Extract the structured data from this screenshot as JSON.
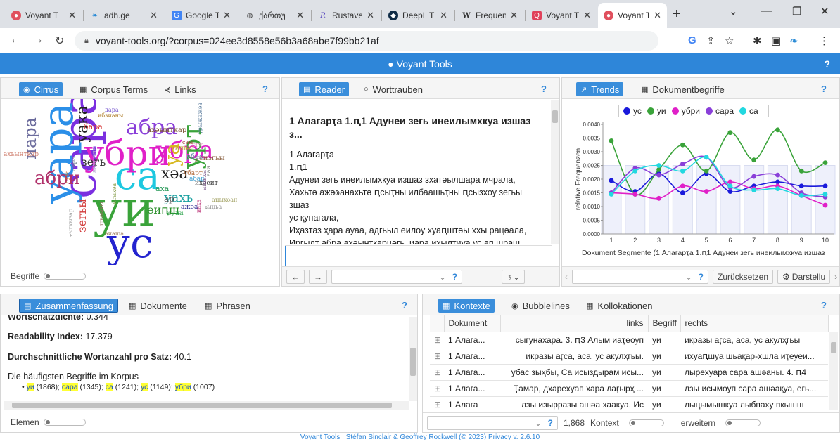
{
  "browser": {
    "tabs": [
      {
        "label": "Voyant T",
        "icon": "voyant-icon",
        "color": "#e0505e"
      },
      {
        "label": "adh.ge",
        "icon": "adh-icon",
        "color": "#2a8bd6"
      },
      {
        "label": "Google T",
        "icon": "translate-icon",
        "color": "#4285f4"
      },
      {
        "label": "ქართუ",
        "icon": "globe-icon",
        "color": "#444444"
      },
      {
        "label": "Rustave",
        "icon": "rustaveli-icon",
        "color": "#5b4bbf"
      },
      {
        "label": "DeepL T",
        "icon": "deepl-icon",
        "color": "#0f2b46"
      },
      {
        "label": "Frequen",
        "icon": "wikipedia-icon",
        "color": "#333333"
      },
      {
        "label": "Voyant T",
        "icon": "voyant-red-icon",
        "color": "#e0405a"
      },
      {
        "label": "Voyant T",
        "icon": "voyant-icon",
        "color": "#e0505e"
      }
    ],
    "url": "voyant-tools.org/?corpus=024ee3d8558e56b3a68abe7f99bb21af"
  },
  "app": {
    "title": "Voyant Tools",
    "help": "?"
  },
  "cirrus": {
    "tabs": [
      "Cirrus",
      "Corpus Terms",
      "Links"
    ],
    "help": "?",
    "slider_label": "Begriffe"
  },
  "reader": {
    "tabs": [
      "Reader",
      "Worttrauben"
    ],
    "help": "?",
    "title": "1 Алагарҭа 1.ԥ1 Адунеи зегь инеилымхкуа изшаз з...",
    "lines": [
      "1 Алагарҭа",
      "1.ԥ1",
      "Адунеи зегь инеилымхкуа изшаз зхатәылшара мчрала,",
      "Хахьтә ажәҩанахьтә ԥсыҭны илбаашьҭны ԥсызхоу зегьы зшаз",
      "ус қунагала,",
      "Иҳазтаз ҳара ауаа, адгьыл еилоу хуаԥштәы ххы рацәала,",
      "Иргылт абра ахәынткарцәгь, иара ихылҭиуа ус ап шраш"
    ]
  },
  "trends": {
    "tabs": [
      "Trends",
      "Dokumentbegriffe"
    ],
    "help": "?",
    "reset_label": "Zurücksetzen",
    "display_label": "Darstellu"
  },
  "chart_data": {
    "type": "line",
    "x": [
      1,
      2,
      3,
      4,
      5,
      6,
      7,
      8,
      9,
      10
    ],
    "xlabel": "Dokument Segmente (1 Алагарҭа 1.ԥ1 Адунеи зегь инеилымхкуа изшаз",
    "ylabel": "relative Frequenzen",
    "ylim": [
      0,
      0.004
    ],
    "yticks": [
      "0.0000",
      "0.0005",
      "0.0010",
      "0.0015",
      "0.0020",
      "0.0025",
      "0.0030",
      "0.0035",
      "0.0040"
    ],
    "legend_position": "top",
    "series": [
      {
        "name": "ус",
        "color": "#1a1adb",
        "values": [
          0.00195,
          0.00155,
          0.0022,
          0.0015,
          0.0022,
          0.00155,
          0.00175,
          0.0019,
          0.00175,
          0.00175
        ]
      },
      {
        "name": "уи",
        "color": "#3aa33a",
        "values": [
          0.0034,
          0.00145,
          0.00235,
          0.00325,
          0.0023,
          0.0037,
          0.0027,
          0.0038,
          0.0023,
          0.0026
        ]
      },
      {
        "name": "убри",
        "color": "#e020c8",
        "values": [
          0.0015,
          0.00145,
          0.0013,
          0.00175,
          0.00155,
          0.0019,
          0.00165,
          0.00175,
          0.0014,
          0.00105
        ]
      },
      {
        "name": "сара",
        "color": "#8a3fd9",
        "values": [
          0.0015,
          0.0024,
          0.00215,
          0.00255,
          0.0028,
          0.0017,
          0.0021,
          0.00215,
          0.0015,
          0.00135
        ]
      },
      {
        "name": "са",
        "color": "#22d8e0",
        "values": [
          0.00145,
          0.0023,
          0.0025,
          0.0023,
          0.0028,
          0.00175,
          0.0016,
          0.00165,
          0.0014,
          0.00145
        ]
      }
    ]
  },
  "summary": {
    "tabs": [
      "Zusammenfassung",
      "Dokumente",
      "Phrasen"
    ],
    "help": "?",
    "density_label": "Wortschatzdichte:",
    "density_value": "0.344",
    "readability_label": "Readability Index:",
    "readability_value": "17.379",
    "avgwords_label": "Durchschnittliche Wortanzahl pro Satz:",
    "avgwords_value": "40.1",
    "frequent_title": "Die häufigsten Begriffe im Korpus",
    "terms": [
      {
        "term": "уи",
        "count": "(1868)"
      },
      {
        "term": "сара",
        "count": "(1345)"
      },
      {
        "term": "са",
        "count": "(1241)"
      },
      {
        "term": "ус",
        "count": "(1149)"
      },
      {
        "term": "убри",
        "count": "(1007)"
      }
    ],
    "slider_label": "Elemen"
  },
  "contexts": {
    "tabs": [
      "Kontexte",
      "Bubblelines",
      "Kollokationen"
    ],
    "help": "?",
    "headers": [
      "Dokument",
      "links",
      "Begriff",
      "rechts"
    ],
    "rows": [
      {
        "doc": "1 Алага...",
        "left": "сыгунахара. 3. ԥ3 Алым иаҭеоуп",
        "term": "уи",
        "right": "икразы аӷса, аса, ус акулҳгьы"
      },
      {
        "doc": "1 Алага...",
        "left": "икразы аӷса, аса, ус акулҳгьы.",
        "term": "уи",
        "right": "ихуаԥшуа шьақар-хшла иҭеуеи..."
      },
      {
        "doc": "1 Алага...",
        "left": "убас зыҳбы, Са исыздырам исы...",
        "term": "уи",
        "right": "лырехуара сара ашәаны. 4. ԥ4"
      },
      {
        "doc": "1 Алага...",
        "left": "Ҭамар, дхарехуап хара лаӷырҳ ...",
        "term": "уи",
        "right": "лзы исымоуп сара ашәақуа, егь..."
      },
      {
        "doc": "1 Алага",
        "left": "лзы изырразы ашәа хаакуа. Ис",
        "term": "уи",
        "right": "лыцымышкуа лыбпаху пкышш"
      }
    ],
    "count": "1,868",
    "context_label": "Kontext",
    "expand_label": "erweitern"
  },
  "footer": {
    "text": "Voyant Tools , Stéfan Sinclair & Geoffrey Rockwell (© 2023) Privacy v. 2.6.10"
  },
  "cirrus_words": [
    {
      "t": "уи",
      "c": "#3aa33a"
    },
    {
      "t": "сара",
      "c": "#7b2fe0"
    },
    {
      "t": "са",
      "c": "#1ec8e0"
    },
    {
      "t": "ус",
      "c": "#2323cf"
    },
    {
      "t": "убри",
      "c": "#e020c8"
    },
    {
      "t": "уара",
      "c": "#2b8fe8"
    },
    {
      "t": "абра",
      "c": "#8a3fd9"
    },
    {
      "t": "убра",
      "c": "#e020c8"
    },
    {
      "t": "урт",
      "c": "#3aa33a"
    },
    {
      "t": "уа",
      "c": "#d6b820"
    },
    {
      "t": "иара",
      "c": "#6b6b9c"
    },
    {
      "t": "уака",
      "c": "#222222"
    },
    {
      "t": "абри",
      "c": "#b0306a"
    },
    {
      "t": "хәа",
      "c": "#1c1c1c"
    },
    {
      "t": "уахь",
      "c": "#1aa0a0"
    },
    {
      "t": "еиԥш",
      "c": "#2b8f2b"
    },
    {
      "t": "зегьы",
      "c": "#d23a3a"
    },
    {
      "t": "зегь",
      "c": "#333333"
    },
    {
      "t": "аха",
      "c": "#2a9a5a"
    },
    {
      "t": "ар",
      "c": "#555555"
    },
    {
      "t": "ауаа",
      "c": "#2ba34a"
    },
    {
      "t": "ажәа",
      "c": "#2a2a90"
    },
    {
      "t": "бара",
      "c": "#d63a3a"
    },
    {
      "t": "ахәынткар",
      "c": "#7a5230"
    },
    {
      "t": "ибзианы",
      "c": "#b08030"
    },
    {
      "t": "дара",
      "c": "#7a5ad0"
    },
    {
      "t": "уеизгьы",
      "c": "#8a6040"
    },
    {
      "t": "убас",
      "c": "#6a8ab0"
    },
    {
      "t": "убарт",
      "c": "#b06a3a"
    },
    {
      "t": "абар",
      "c": "#40a0d0"
    },
    {
      "t": "иҳәеит",
      "c": "#444444"
    },
    {
      "t": "ашәа",
      "c": "#c0a030"
    },
    {
      "t": "сгу",
      "c": "#e0a0c0"
    },
    {
      "t": "сзы",
      "c": "#a03030"
    },
    {
      "t": "иара",
      "c": "#708090"
    },
    {
      "t": "ахьынтқар",
      "c": "#d08070"
    },
    {
      "t": "амшала",
      "c": "#b0a0d0"
    },
    {
      "t": "ауха",
      "c": "#c07030"
    },
    {
      "t": "аиаша",
      "c": "#a08060"
    },
    {
      "t": "исыҳәа",
      "c": "#8aa050"
    },
    {
      "t": "шьамхы",
      "c": "#907060"
    },
    {
      "t": "ашьха",
      "c": "#806090"
    },
    {
      "t": "иаҳа",
      "c": "#c04080"
    },
    {
      "t": "ааи",
      "c": "#808080"
    },
    {
      "t": "ҽыгхызар",
      "c": "#a0a0a0"
    },
    {
      "t": "ҩыџьа",
      "c": "#909090"
    },
    {
      "t": "урыжәжәа",
      "c": "#6080a0"
    },
    {
      "t": "аҵыхәан",
      "c": "#a0a060"
    }
  ]
}
